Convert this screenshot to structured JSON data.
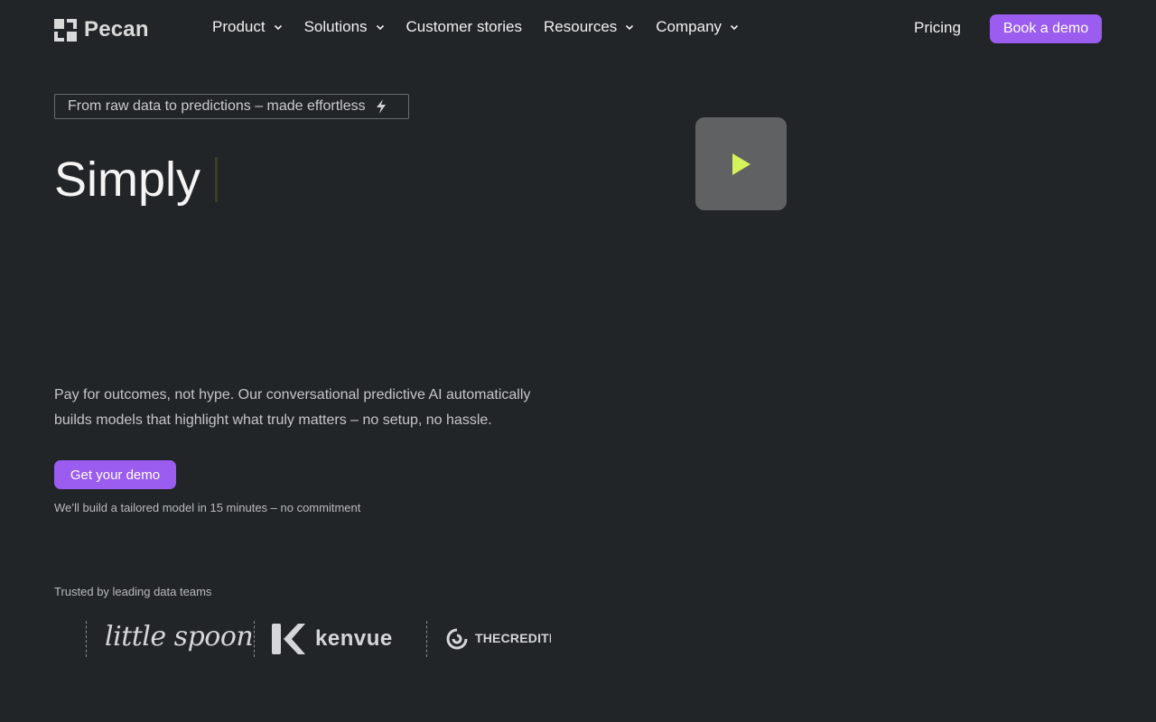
{
  "brand": {
    "name": "Pecan"
  },
  "nav": {
    "items": [
      {
        "label": "Product",
        "has_dropdown": true
      },
      {
        "label": "Solutions",
        "has_dropdown": true
      },
      {
        "label": "Customer stories",
        "has_dropdown": false
      },
      {
        "label": "Resources",
        "has_dropdown": true
      },
      {
        "label": "Company",
        "has_dropdown": true
      }
    ],
    "pricing": "Pricing",
    "cta": "Book a demo"
  },
  "hero": {
    "tagline": "From raw data to predictions – made effortless",
    "headline": "Simply",
    "description": "Pay for outcomes, not hype. Our conversational predictive AI automatically builds models that highlight what truly matters – no setup, no hassle.",
    "cta": "Get your demo",
    "note": "We’ll build a tailored model in 15 minutes – no commitment"
  },
  "trusted": {
    "label": "Trusted by leading data teams",
    "logos": [
      "little spoon",
      "kenvue",
      "THECREDITP"
    ]
  },
  "colors": {
    "background": "#222527",
    "accent": "#9b5cf0",
    "play_icon": "#d4f25a"
  },
  "icons": [
    "pecan-logo-icon",
    "chevron-down-icon",
    "lightning-bolt-icon",
    "play-icon"
  ]
}
